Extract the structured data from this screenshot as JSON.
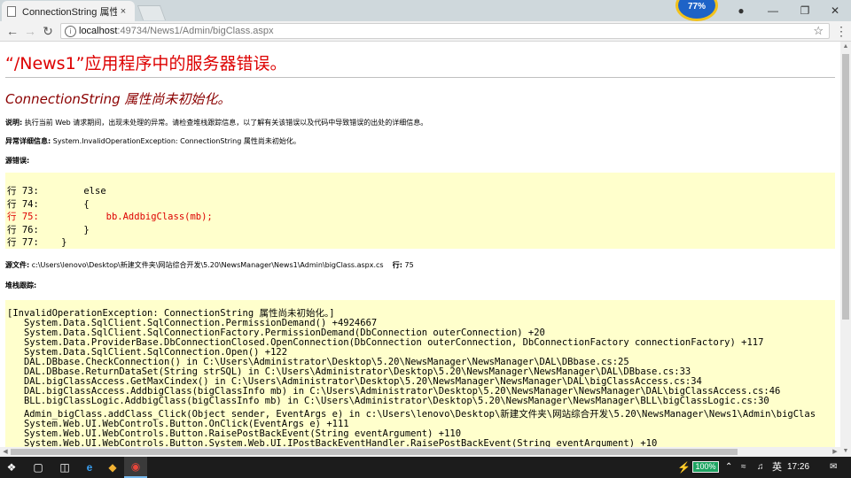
{
  "browser": {
    "tab_title": "ConnectionString 属性尚...",
    "tab_close": "×",
    "badge_text": "77%",
    "address": {
      "host": "localhost",
      "path": ":49734/News1/Admin/bigClass.aspx"
    }
  },
  "page": {
    "title": "“/News1”应用程序中的服务器错误。",
    "error_title": "ConnectionString 属性尚未初始化。",
    "description_label": "说明:",
    "description_text": " 执行当前 Web 请求期间，出现未处理的异常。请检查堆栈跟踪信息，以了解有关该错误以及代码中导致错误的出处的详细信息。",
    "exception_label": "异常详细信息:",
    "exception_text": " System.InvalidOperationException: ConnectionString 属性尚未初始化。",
    "source_error_label": "源错误:",
    "source_lines": [
      {
        "text": "行 73:        else",
        "highlight": false
      },
      {
        "text": "行 74:        {",
        "highlight": false
      },
      {
        "text": "行 75:            bb.AddbigClass(mb);",
        "highlight": true
      },
      {
        "text": "行 76:        }",
        "highlight": false
      },
      {
        "text": "行 77:    }",
        "highlight": false
      }
    ],
    "source_file_label": "源文件:",
    "source_file_path": " c:\\Users\\lenovo\\Desktop\\新建文件夹\\网站综合开发\\5.20\\NewsManager\\News1\\Admin\\bigClass.aspx.cs",
    "line_label": "行:",
    "line_number": " 75",
    "stack_label": "堆栈跟踪:",
    "stack_lines": [
      "[InvalidOperationException: ConnectionString 属性尚未初始化。]",
      "   System.Data.SqlClient.SqlConnection.PermissionDemand() +4924667",
      "   System.Data.SqlClient.SqlConnectionFactory.PermissionDemand(DbConnection outerConnection) +20",
      "   System.Data.ProviderBase.DbConnectionClosed.OpenConnection(DbConnection outerConnection, DbConnectionFactory connectionFactory) +117",
      "   System.Data.SqlClient.SqlConnection.Open() +122",
      "   DAL.DBbase.CheckConnection() in C:\\Users\\Administrator\\Desktop\\5.20\\NewsManager\\NewsManager\\DAL\\DBbase.cs:25",
      "   DAL.DBbase.ReturnDataSet(String strSQL) in C:\\Users\\Administrator\\Desktop\\5.20\\NewsManager\\NewsManager\\DAL\\DBbase.cs:33",
      "   DAL.bigClassAccess.GetMaxCindex() in C:\\Users\\Administrator\\Desktop\\5.20\\NewsManager\\NewsManager\\DAL\\bigClassAccess.cs:34",
      "   DAL.bigClassAccess.AddbigClass(bigClassInfo mb) in C:\\Users\\Administrator\\Desktop\\5.20\\NewsManager\\NewsManager\\DAL\\bigClassAccess.cs:46",
      "   BLL.bigClassLogic.AddbigClass(bigClassInfo mb) in C:\\Users\\Administrator\\Desktop\\5.20\\NewsManager\\NewsManager\\BLL\\bigClassLogic.cs:30",
      "   Admin_bigClass.addClass_Click(Object sender, EventArgs e) in c:\\Users\\lenovo\\Desktop\\新建文件夹\\网站综合开发\\5.20\\NewsManager\\News1\\Admin\\bigClas",
      "   System.Web.UI.WebControls.Button.OnClick(EventArgs e) +111",
      "   System.Web.UI.WebControls.Button.RaisePostBackEvent(String eventArgument) +110",
      "   System.Web.UI.WebControls.Button.System.Web.UI.IPostBackEventHandler.RaisePostBackEvent(String eventArgument) +10"
    ]
  },
  "taskbar": {
    "battery": "100%",
    "ime": "英",
    "time": "17:26"
  },
  "colors": {
    "error_red": "#dd0000",
    "dark_red": "#8b0000",
    "code_background": "#ffffcc",
    "taskbar": "#1c1c1c"
  }
}
